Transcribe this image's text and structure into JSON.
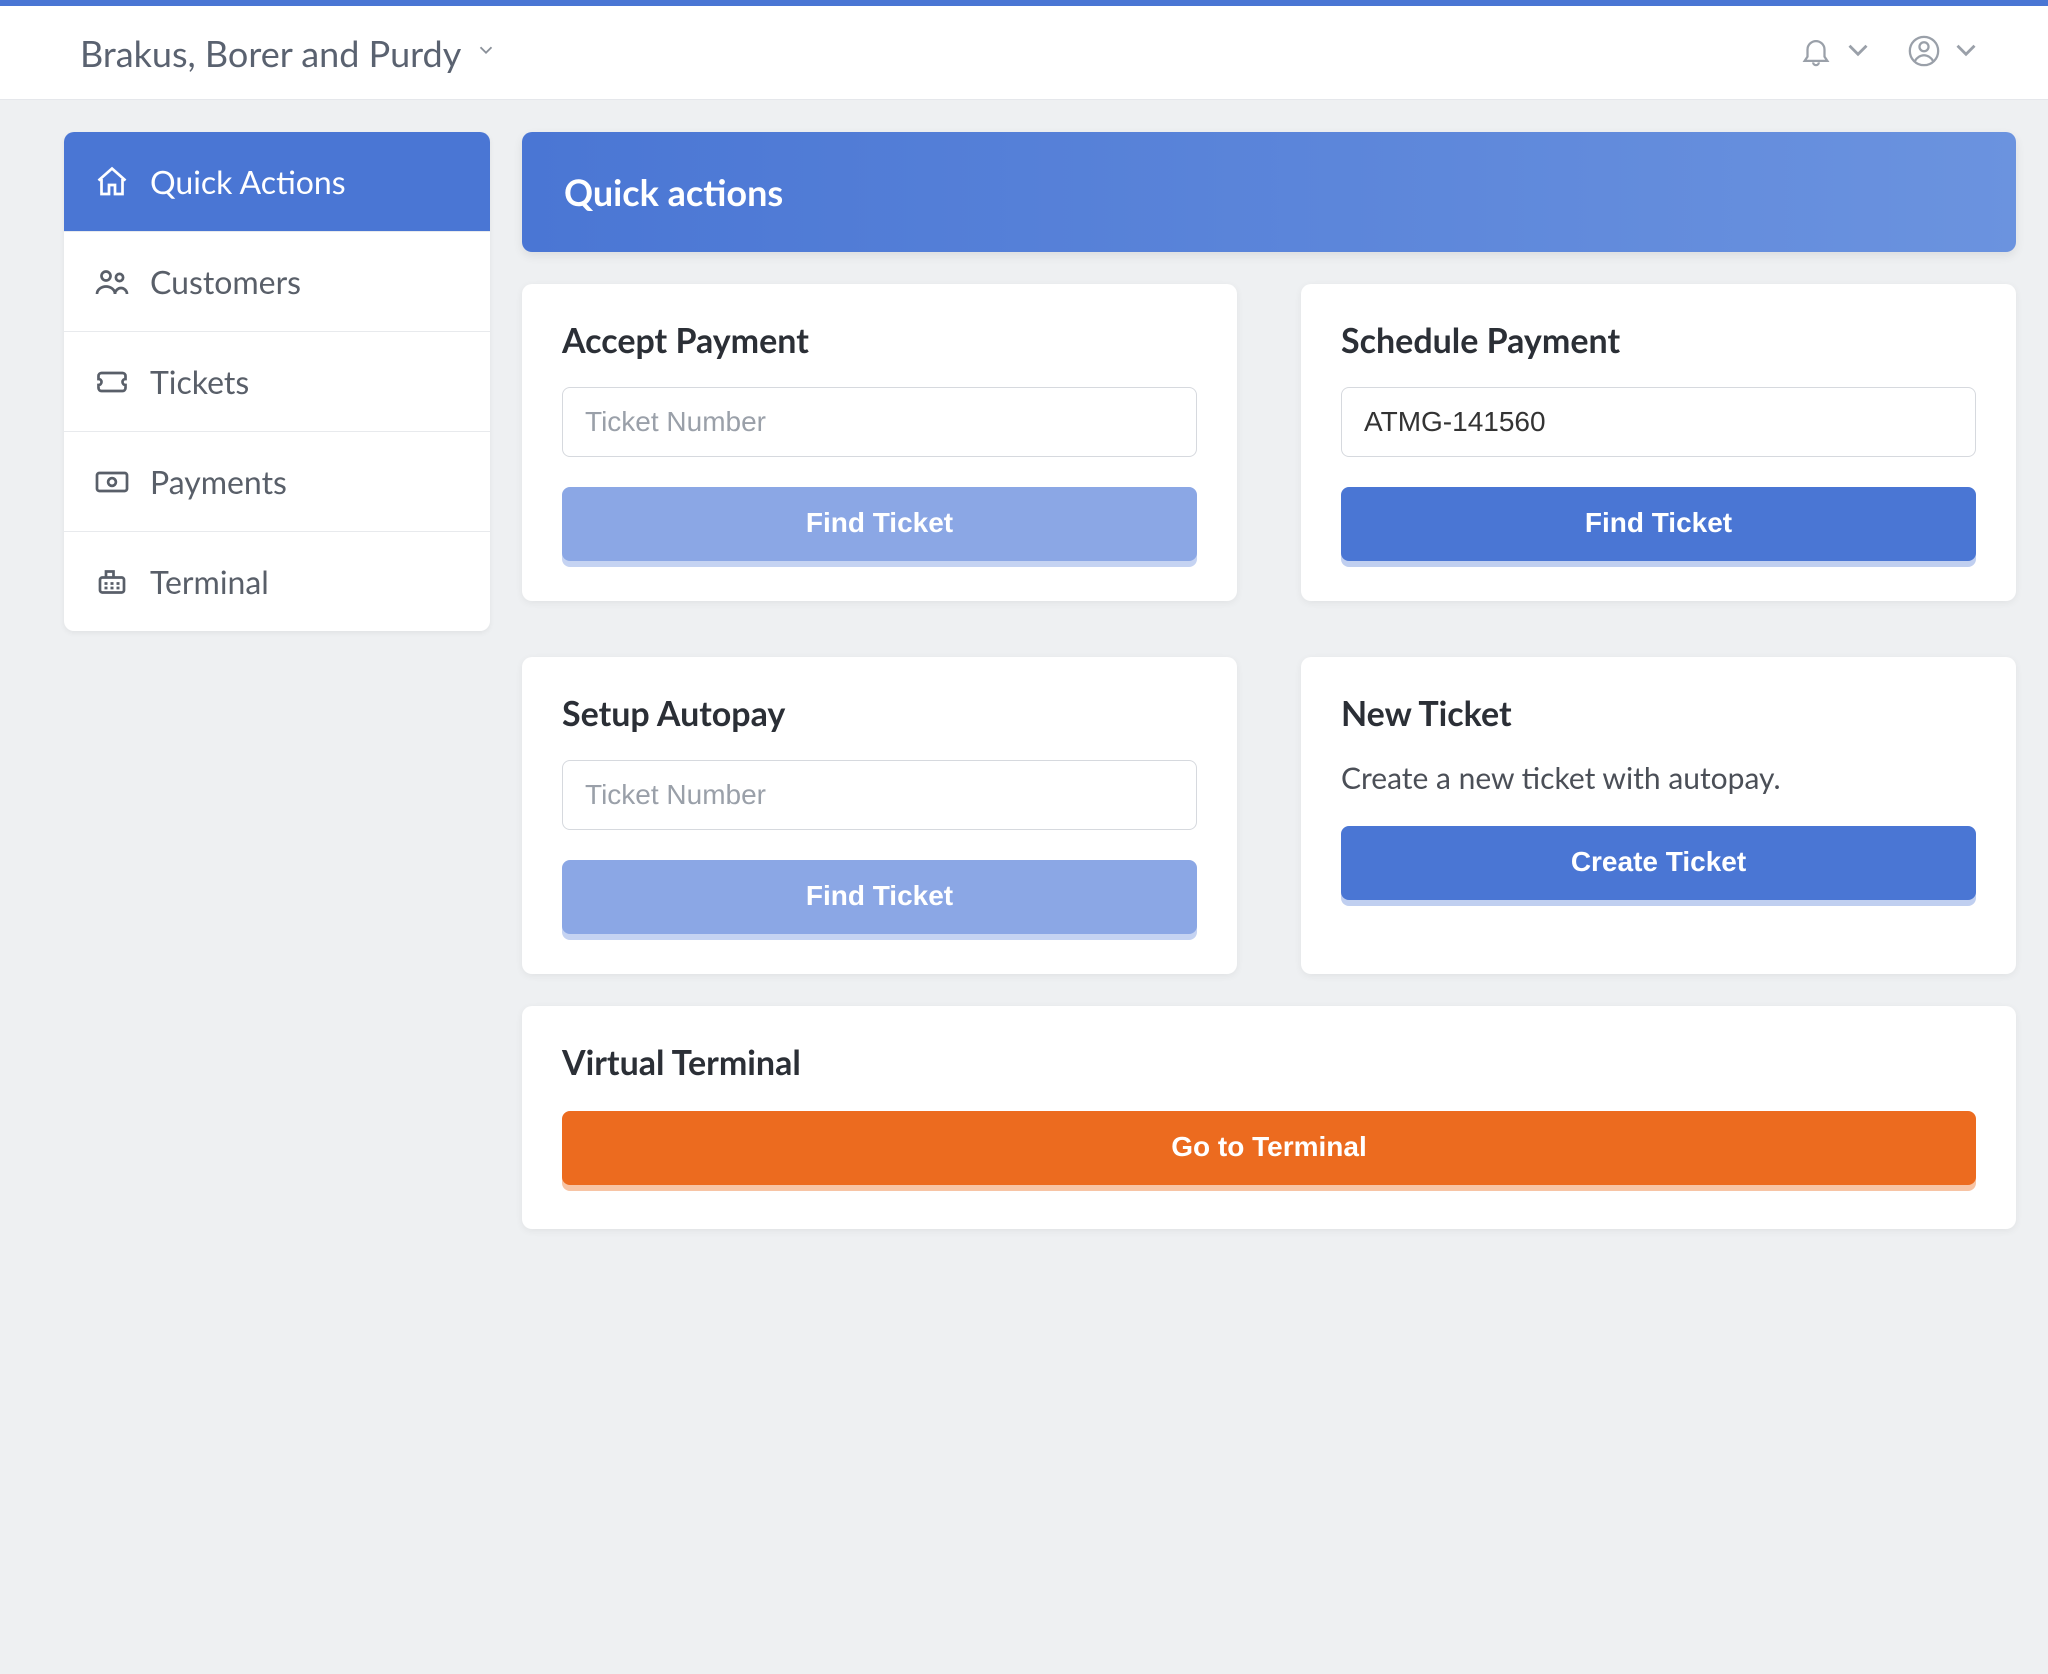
{
  "header": {
    "org_name": "Brakus, Borer and Purdy"
  },
  "sidebar": {
    "items": [
      {
        "label": "Quick Actions",
        "icon": "home",
        "active": true
      },
      {
        "label": "Customers",
        "icon": "users",
        "active": false
      },
      {
        "label": "Tickets",
        "icon": "ticket",
        "active": false
      },
      {
        "label": "Payments",
        "icon": "cash",
        "active": false
      },
      {
        "label": "Terminal",
        "icon": "register",
        "active": false
      }
    ]
  },
  "page_title": "Quick actions",
  "cards": {
    "accept_payment": {
      "title": "Accept Payment",
      "placeholder": "Ticket Number",
      "value": "",
      "button": "Find Ticket"
    },
    "schedule_payment": {
      "title": "Schedule Payment",
      "placeholder": "Ticket Number",
      "value": "ATMG-141560",
      "button": "Find Ticket"
    },
    "setup_autopay": {
      "title": "Setup Autopay",
      "placeholder": "Ticket Number",
      "value": "",
      "button": "Find Ticket"
    },
    "new_ticket": {
      "title": "New Ticket",
      "description": "Create a new ticket with autopay.",
      "button": "Create Ticket"
    },
    "virtual_terminal": {
      "title": "Virtual Terminal",
      "button": "Go to Terminal"
    }
  }
}
